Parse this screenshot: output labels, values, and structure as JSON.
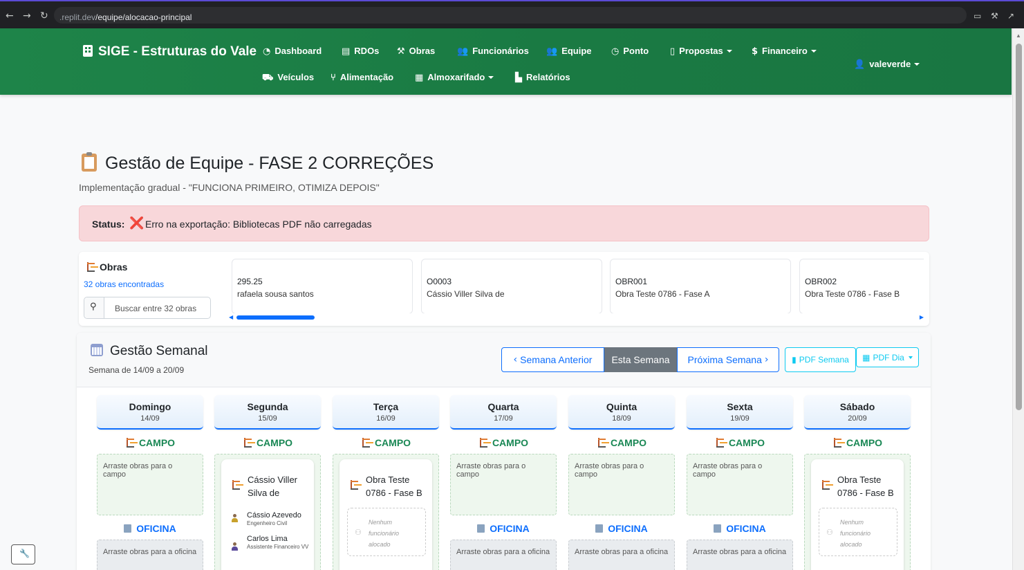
{
  "browser": {
    "url_dim": ".replit.dev",
    "url_path": "/equipe/alocacao-principal"
  },
  "navbar": {
    "brand": "SIGE - Estruturas do Vale",
    "items": [
      {
        "label": "Dashboard",
        "icon": "gauge-icon"
      },
      {
        "label": "RDOs",
        "icon": "clipboard-icon"
      },
      {
        "label": "Obras",
        "icon": "hammer-icon"
      },
      {
        "label": "Funcionários",
        "icon": "users-icon"
      },
      {
        "label": "Equipe",
        "icon": "user-group-icon"
      },
      {
        "label": "Ponto",
        "icon": "clock-icon"
      },
      {
        "label": "Propostas",
        "icon": "file-icon"
      },
      {
        "label": "Financeiro",
        "icon": "dollar-icon"
      },
      {
        "label": "Veículos",
        "icon": "car-icon"
      },
      {
        "label": "Alimentação",
        "icon": "utensils-icon"
      },
      {
        "label": "Almoxarifado",
        "icon": "boxes-icon"
      },
      {
        "label": "Relatórios",
        "icon": "chart-icon"
      }
    ],
    "user": "valeverde"
  },
  "header": {
    "title": "Gestão de Equipe - FASE 2 CORREÇÕES",
    "subtitle": "Implementação gradual - \"FUNCIONA PRIMEIRO, OTIMIZA DEPOIS\""
  },
  "alert": {
    "label": "Status:",
    "icon": "❌",
    "message": "Erro na exportação: Bibliotecas PDF não carregadas"
  },
  "obras": {
    "title": "Obras",
    "count": "32 obras encontradas",
    "search_placeholder": "Buscar entre 32 obras",
    "cards": [
      {
        "code": "295.25",
        "name": "rafaela sousa santos"
      },
      {
        "code": "O0003",
        "name": "Cássio Viller Silva de"
      },
      {
        "code": "OBR001",
        "name": "Obra Teste 0786 - Fase A"
      },
      {
        "code": "OBR002",
        "name": "Obra Teste 0786 - Fase B"
      }
    ]
  },
  "week": {
    "title": "Gestão Semanal",
    "range": "Semana de 14/09 a 20/09",
    "buttons": {
      "prev": "Semana Anterior",
      "current": "Esta Semana",
      "next": "Próxima Semana",
      "pdf_week": "PDF Semana",
      "pdf_day": "PDF Dia"
    },
    "campo_label": "CAMPO",
    "oficina_label": "OFICINA",
    "campo_empty": "Arraste obras para o campo",
    "oficina_empty": "Arraste obras para a oficina",
    "no_staff": "Nenhum funcionário alocado",
    "days": [
      {
        "name": "Domingo",
        "date": "14/09"
      },
      {
        "name": "Segunda",
        "date": "15/09",
        "obra": "Cássio Viller Silva de",
        "employees": [
          {
            "name": "Cássio Azevedo",
            "role": "Engenheiro Civil"
          },
          {
            "name": "Carlos Lima",
            "role": "Assistente Financeiro VV"
          }
        ]
      },
      {
        "name": "Terça",
        "date": "16/09",
        "obra": "Obra Teste 0786 - Fase B"
      },
      {
        "name": "Quarta",
        "date": "17/09"
      },
      {
        "name": "Quinta",
        "date": "18/09"
      },
      {
        "name": "Sexta",
        "date": "19/09"
      },
      {
        "name": "Sábado",
        "date": "20/09",
        "obra": "Obra Teste 0786 - Fase B"
      }
    ]
  },
  "colors": {
    "navbar": "#1e8449",
    "primary": "#0d6efd",
    "campo": "#198754",
    "alert_bg": "#f8d7da"
  }
}
